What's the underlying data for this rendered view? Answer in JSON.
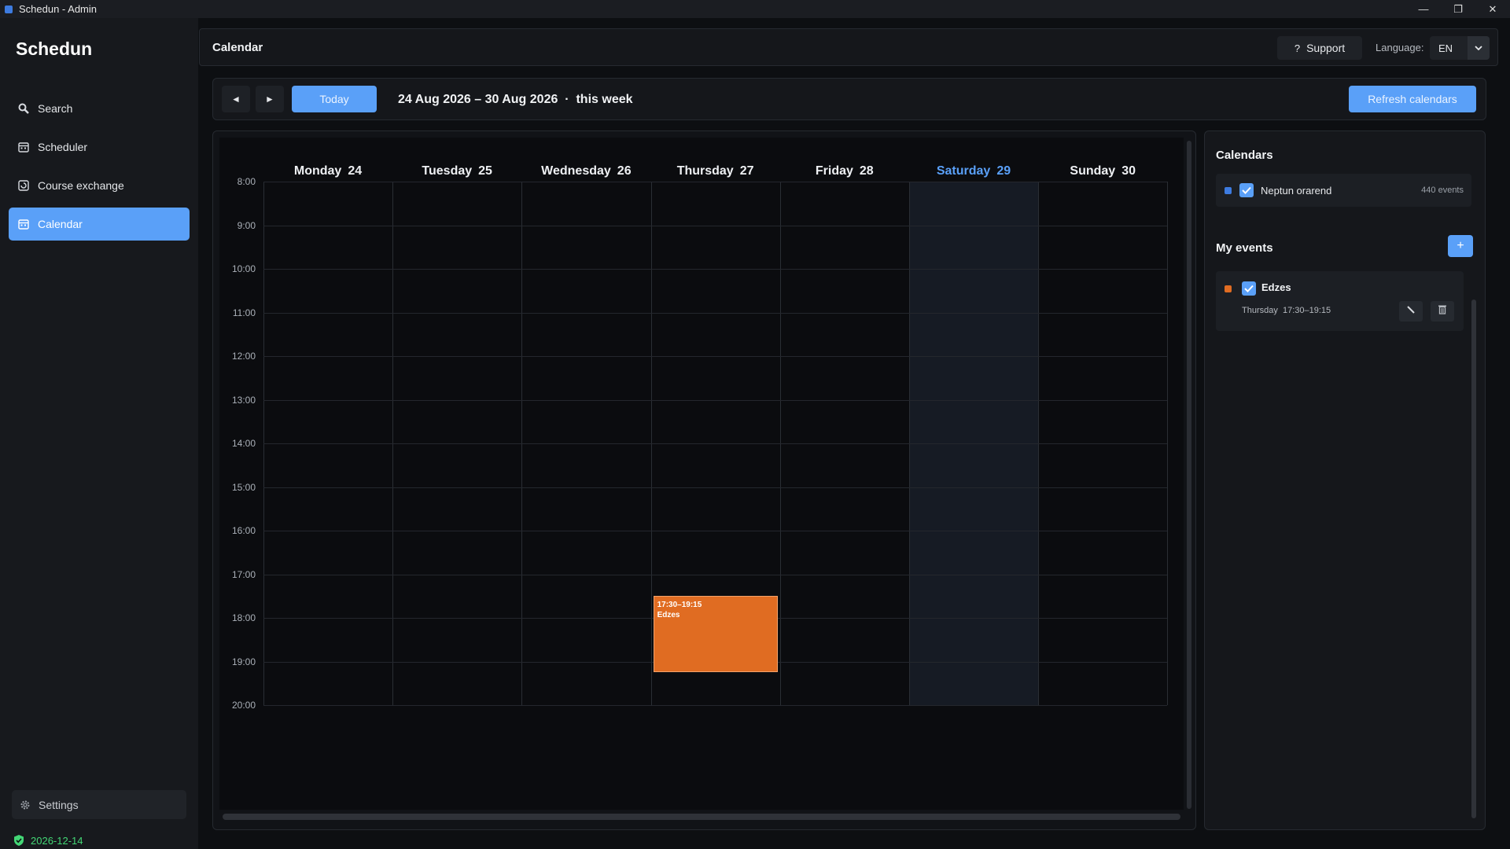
{
  "window": {
    "title": "Schedun - Admin"
  },
  "sidebar": {
    "brand": "Schedun",
    "items": [
      {
        "label": "Search",
        "icon": "search-icon"
      },
      {
        "label": "Scheduler",
        "icon": "scheduler-icon"
      },
      {
        "label": "Course exchange",
        "icon": "exchange-icon"
      },
      {
        "label": "Calendar",
        "icon": "calendar-icon",
        "active": true
      }
    ],
    "settings_label": "Settings",
    "license_date": "2026-12-14"
  },
  "header": {
    "title": "Calendar",
    "support_label": "Support",
    "language_label": "Language:",
    "language_value": "EN"
  },
  "toolbar": {
    "prev_label": "◄",
    "next_label": "►",
    "today_label": "Today",
    "range": "24 Aug 2026 – 30 Aug 2026  ·  this week",
    "refresh_label": "Refresh calendars"
  },
  "calendar": {
    "days": [
      {
        "name": "Monday",
        "date": "24"
      },
      {
        "name": "Tuesday",
        "date": "25"
      },
      {
        "name": "Wednesday",
        "date": "26"
      },
      {
        "name": "Thursday",
        "date": "27"
      },
      {
        "name": "Friday",
        "date": "28"
      },
      {
        "name": "Saturday",
        "date": "29",
        "today": true
      },
      {
        "name": "Sunday",
        "date": "30"
      }
    ],
    "hours": [
      "8:00",
      "9:00",
      "10:00",
      "11:00",
      "12:00",
      "13:00",
      "14:00",
      "15:00",
      "16:00",
      "17:00",
      "18:00",
      "19:00",
      "20:00"
    ],
    "events": [
      {
        "day": "Thursday",
        "start": "17:30",
        "end": "19:15",
        "time_label": "17:30–19:15",
        "title": "Edzes",
        "color": "#e06c22"
      }
    ],
    "today_color": "#5aa0f8"
  },
  "side": {
    "calendars_title": "Calendars",
    "calendars": [
      {
        "name": "Neptun orarend",
        "count": "440 events",
        "color": "#3d7be0",
        "checked": true
      }
    ],
    "my_events_title": "My events",
    "add_label": "+",
    "my_events": [
      {
        "name": "Edzes",
        "time": "Thursday  17:30–19:15",
        "color": "#e06c22",
        "checked": true
      }
    ]
  },
  "colors": {
    "accent": "#5aa0f8",
    "event": "#e06c22",
    "license": "#43d675"
  }
}
